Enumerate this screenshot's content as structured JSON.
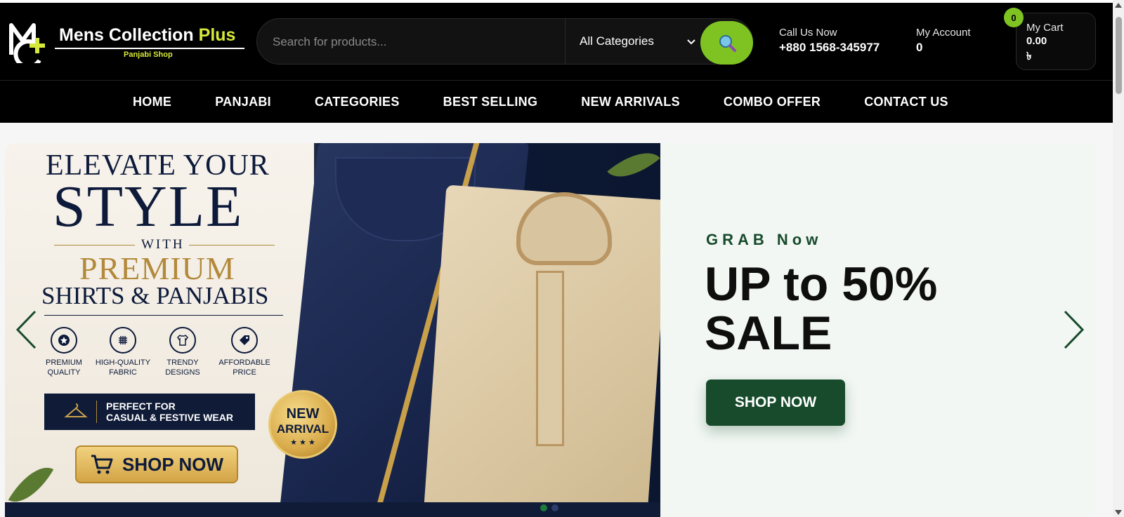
{
  "brand": {
    "name_main": "Mens Collection ",
    "name_plus": "Plus",
    "sub": "Panjabi Shop"
  },
  "search": {
    "placeholder": "Search for products...",
    "category_selected": "All Categories"
  },
  "contact": {
    "label": "Call Us Now",
    "phone": "+880 1568-345977"
  },
  "account": {
    "label": "My Account",
    "value": "0"
  },
  "cart": {
    "label": "My Cart",
    "amount": "0.00",
    "currency": "৳",
    "count": "0"
  },
  "nav": {
    "items": [
      "HOME",
      "PANJABI",
      "CATEGORIES",
      "BEST SELLING",
      "NEW ARRIVALS",
      "COMBO OFFER",
      "CONTACT US"
    ]
  },
  "banner": {
    "line1": "ELEVATE YOUR",
    "line2": "STYLE",
    "line3": "WITH",
    "line4": "PREMIUM",
    "line5": "SHIRTS & PANJABIS",
    "features": [
      {
        "l1": "PREMIUM",
        "l2": "QUALITY",
        "icon": "star-badge-icon"
      },
      {
        "l1": "HIGH-QUALITY",
        "l2": "FABRIC",
        "icon": "fabric-grid-icon"
      },
      {
        "l1": "TRENDY",
        "l2": "DESIGNS",
        "icon": "shirt-icon"
      },
      {
        "l1": "AFFORDABLE",
        "l2": "PRICE",
        "icon": "price-tag-icon"
      }
    ],
    "perfect_l1": "PERFECT FOR",
    "perfect_l2": "CASUAL & FESTIVE WEAR",
    "badge_l1": "NEW",
    "badge_l2": "ARRIVAL",
    "badge_stars": "★ ★ ★",
    "shop_label": "SHOP NOW"
  },
  "promo": {
    "kicker": "GRAB Now",
    "title": "UP to 50% SALE",
    "button": "SHOP NOW"
  },
  "colors": {
    "accent_green": "#7ec322",
    "promo_green": "#174b2c",
    "navy": "#0d1a3a",
    "gold": "#b3893a"
  }
}
